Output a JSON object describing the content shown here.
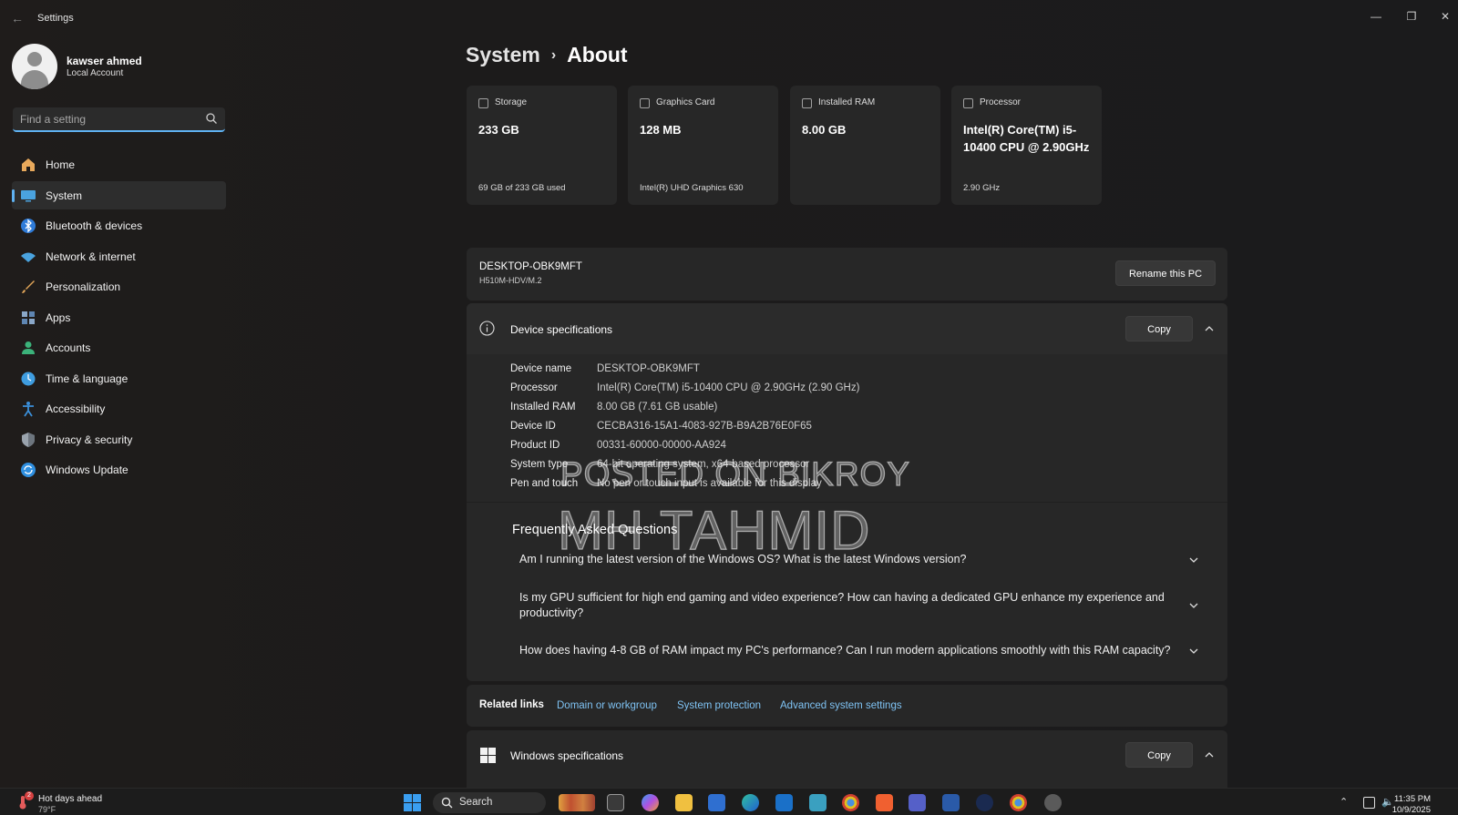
{
  "window": {
    "title": "Settings",
    "controls": {
      "minimize": "—",
      "restore": "❐",
      "close": "✕"
    }
  },
  "profile": {
    "name": "kawser ahmed",
    "account_type": "Local Account"
  },
  "search": {
    "placeholder": "Find a setting"
  },
  "sidebar": {
    "items": [
      {
        "label": "Home",
        "icon": "home-icon",
        "color": "#e8a95c"
      },
      {
        "label": "System",
        "icon": "monitor-icon",
        "color": "#4aa3df",
        "active": true
      },
      {
        "label": "Bluetooth & devices",
        "icon": "bluetooth-icon",
        "color": "#2f7bd8"
      },
      {
        "label": "Network & internet",
        "icon": "wifi-icon",
        "color": "#4aa3df"
      },
      {
        "label": "Personalization",
        "icon": "brush-icon",
        "color": "#e0a458"
      },
      {
        "label": "Apps",
        "icon": "apps-icon",
        "color": "#8aa7c8"
      },
      {
        "label": "Accounts",
        "icon": "person-icon",
        "color": "#3bb27a"
      },
      {
        "label": "Time & language",
        "icon": "globe-clock-icon",
        "color": "#3f9de0"
      },
      {
        "label": "Accessibility",
        "icon": "accessibility-icon",
        "color": "#3b8fd9"
      },
      {
        "label": "Privacy & security",
        "icon": "shield-icon",
        "color": "#9aa3ad"
      },
      {
        "label": "Windows Update",
        "icon": "update-icon",
        "color": "#2f8fe0"
      }
    ]
  },
  "breadcrumb": {
    "root": "System",
    "current": "About"
  },
  "cards": [
    {
      "label": "Storage",
      "icon": "storage-icon",
      "value": "233 GB",
      "sub": "69 GB of 233 GB used"
    },
    {
      "label": "Graphics Card",
      "icon": "gpu-icon",
      "value": "128 MB",
      "sub": "Intel(R) UHD Graphics 630"
    },
    {
      "label": "Installed RAM",
      "icon": "ram-icon",
      "value": "8.00 GB",
      "sub": ""
    },
    {
      "label": "Processor",
      "icon": "cpu-icon",
      "value": "Intel(R) Core(TM) i5-10400 CPU @ 2.90GHz",
      "sub": "2.90 GHz"
    }
  ],
  "pc": {
    "name": "DESKTOP-OBK9MFT",
    "model": "H510M-HDV/M.2",
    "rename_label": "Rename this PC"
  },
  "device_specs": {
    "title": "Device specifications",
    "copy_label": "Copy",
    "rows": [
      {
        "key": "Device name",
        "value": "DESKTOP-OBK9MFT"
      },
      {
        "key": "Processor",
        "value": "Intel(R) Core(TM) i5-10400 CPU @ 2.90GHz (2.90 GHz)"
      },
      {
        "key": "Installed RAM",
        "value": "8.00 GB (7.61 GB usable)"
      },
      {
        "key": "Device ID",
        "value": "CECBA316-15A1-4083-927B-B9A2B76E0F65"
      },
      {
        "key": "Product ID",
        "value": "00331-60000-00000-AA924"
      },
      {
        "key": "System type",
        "value": "64-bit operating system, x64-based processor"
      },
      {
        "key": "Pen and touch",
        "value": "No pen or touch input is available for this display"
      }
    ]
  },
  "faq": {
    "title": "Frequently Asked Questions",
    "items": [
      "Am I running the latest version of the Windows OS? What is the latest Windows version?",
      "Is my GPU sufficient for high end gaming and video experience? How can having a dedicated GPU enhance my experience and productivity?",
      "How does having 4-8 GB of RAM impact my PC's performance? Can I run modern applications smoothly with this RAM capacity?"
    ]
  },
  "related_links": {
    "title": "Related links",
    "links": [
      "Domain or workgroup",
      "System protection",
      "Advanced system settings"
    ]
  },
  "windows_specs": {
    "title": "Windows specifications",
    "copy_label": "Copy"
  },
  "watermarks": [
    "POSTED ON BIKROY",
    "MH TAHMID"
  ],
  "taskbar": {
    "weather": {
      "title": "Hot days ahead",
      "temp": "79°F",
      "badge": "2"
    },
    "search_label": "Search",
    "clock": {
      "time": "11:35 PM",
      "date": "10/9/2025"
    },
    "colors": {
      "accent": "#5fb2f2",
      "link": "#7fc3f4"
    }
  }
}
